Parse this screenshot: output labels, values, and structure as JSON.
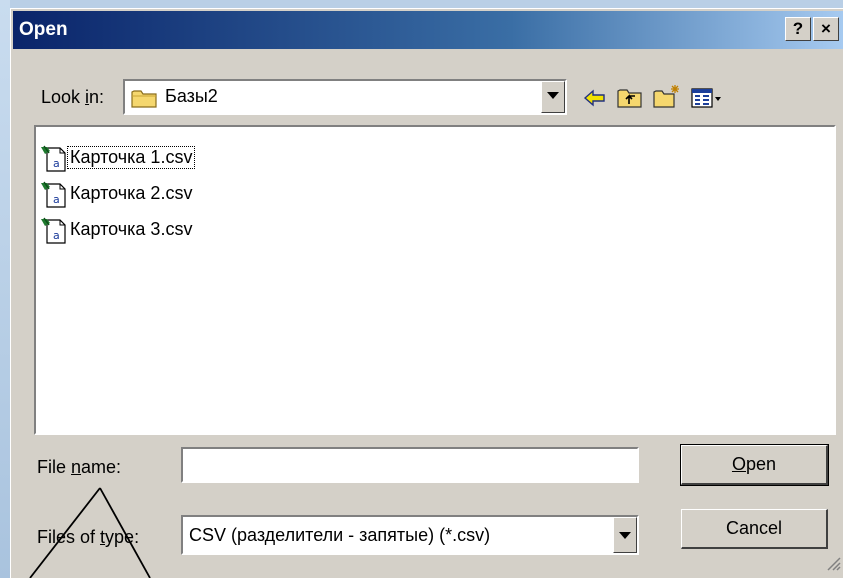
{
  "window": {
    "title": "Open",
    "help_label": "?",
    "close_label": "×"
  },
  "look_in": {
    "label_pre": "Look ",
    "label_underline": "i",
    "label_post": "n:",
    "value": "Базы2"
  },
  "toolbar": {
    "icons": [
      "back-arrow-icon",
      "up-one-level-icon",
      "new-folder-icon",
      "view-menu-icon"
    ]
  },
  "files": [
    {
      "name": "Карточка 1.csv",
      "icon": "csv-file-icon"
    },
    {
      "name": "Карточка 2.csv",
      "icon": "csv-file-icon"
    },
    {
      "name": "Карточка 3.csv",
      "icon": "csv-file-icon"
    }
  ],
  "file_name": {
    "label_pre": "File ",
    "label_underline": "n",
    "label_post": "ame:",
    "value": ""
  },
  "file_type": {
    "label_pre": "Files of ",
    "label_underline": "t",
    "label_post": "ype:",
    "value": "CSV (разделители - запятые) (*.csv)"
  },
  "buttons": {
    "open_underline": "O",
    "open_rest": "pen",
    "cancel": "Cancel"
  },
  "colors": {
    "title_start": "#0a246a",
    "title_end": "#a6caf0",
    "dialog_face": "#d4d0c8"
  }
}
